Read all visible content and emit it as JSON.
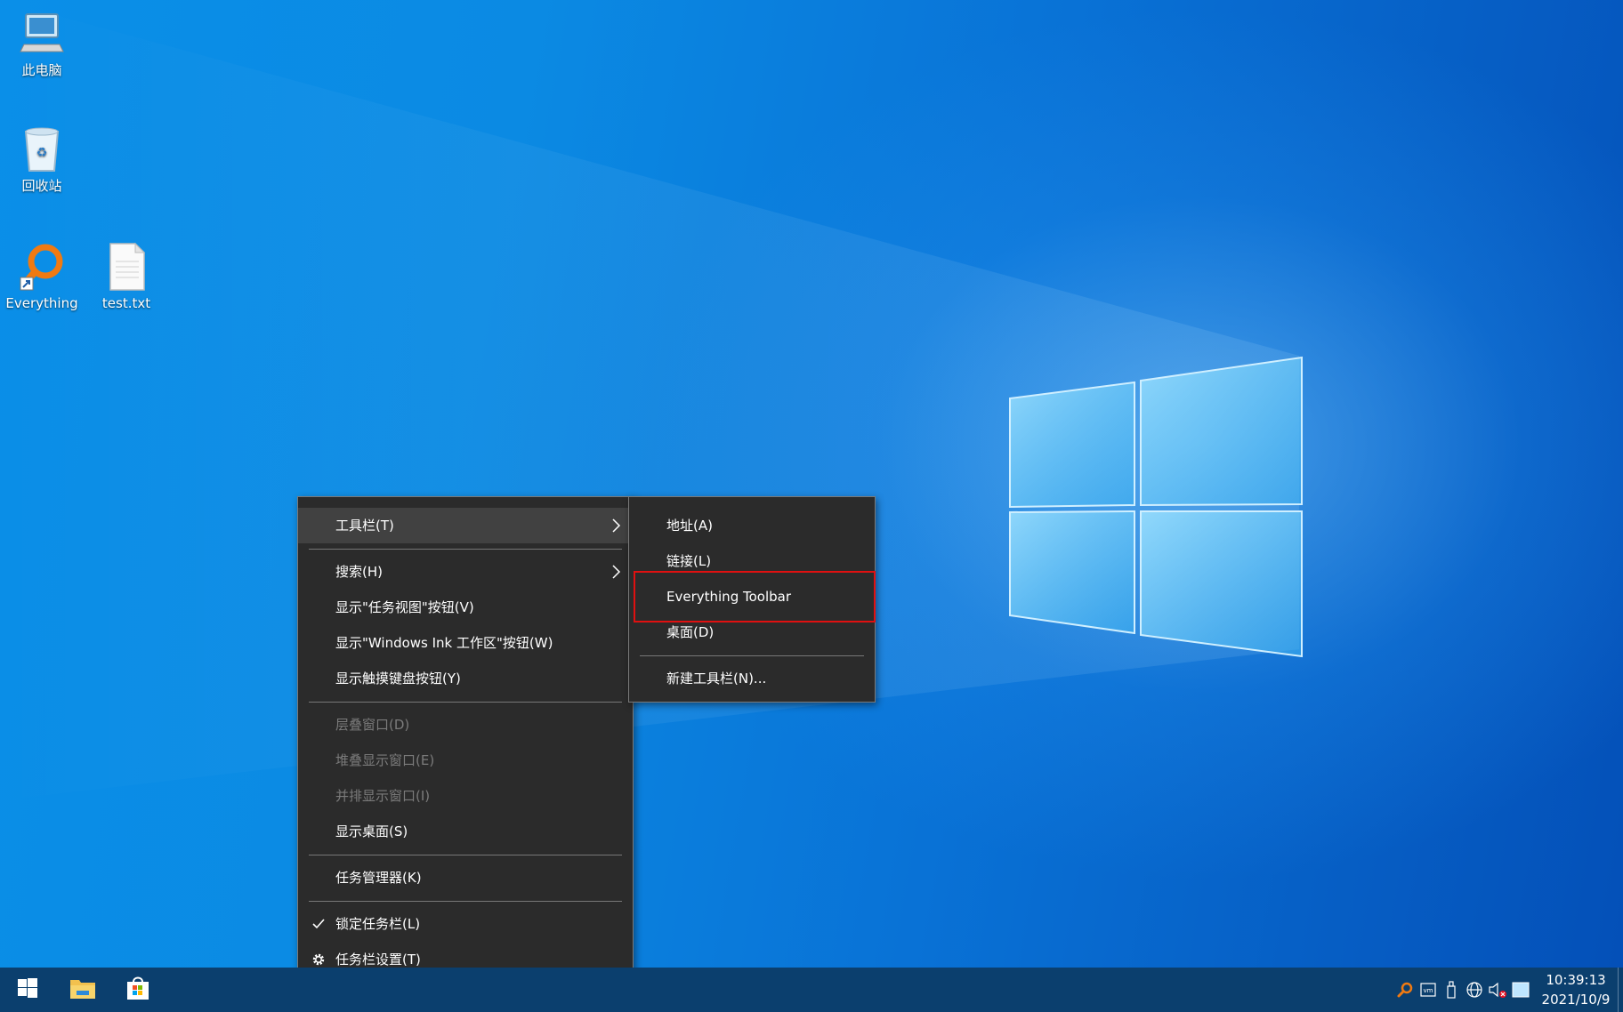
{
  "desktop": {
    "icons": [
      {
        "label": "此电脑",
        "icon": "computer-icon"
      },
      {
        "label": "回收站",
        "icon": "recycle-bin-icon"
      },
      {
        "label": "Everything",
        "icon": "everything-icon"
      },
      {
        "label": "test.txt",
        "icon": "text-file-icon"
      }
    ]
  },
  "context_menu": {
    "items": [
      {
        "label": "工具栏(T)",
        "has_submenu": true,
        "active": true
      },
      {
        "label": "搜索(H)",
        "has_submenu": true
      },
      {
        "label": "显示\"任务视图\"按钮(V)"
      },
      {
        "label": "显示\"Windows Ink 工作区\"按钮(W)"
      },
      {
        "label": "显示触摸键盘按钮(Y)"
      },
      {
        "label": "层叠窗口(D)",
        "disabled": true
      },
      {
        "label": "堆叠显示窗口(E)",
        "disabled": true
      },
      {
        "label": "并排显示窗口(I)",
        "disabled": true
      },
      {
        "label": "显示桌面(S)"
      },
      {
        "label": "任务管理器(K)"
      },
      {
        "label": "锁定任务栏(L)",
        "checked": true
      },
      {
        "label": "任务栏设置(T)",
        "icon": "gear-icon"
      }
    ]
  },
  "toolbar_submenu": {
    "items": [
      {
        "label": "地址(A)"
      },
      {
        "label": "链接(L)"
      },
      {
        "label": "Everything Toolbar",
        "highlighted": true
      },
      {
        "label": "桌面(D)"
      },
      {
        "label": "新建工具栏(N)..."
      }
    ]
  },
  "taskbar": {
    "clock_time": "10:39:13",
    "clock_date": "2021/10/9",
    "pinned": [
      "start-icon",
      "file-explorer-icon",
      "store-icon"
    ],
    "tray": [
      "everything-tray-icon",
      "vmware-icon",
      "usb-icon",
      "network-icon",
      "volume-muted-icon",
      "action-center-icon"
    ]
  },
  "colors": {
    "highlight_border": "#e01010",
    "menu_bg": "#2b2b2b",
    "taskbar_bg": "#0b3f6e"
  }
}
